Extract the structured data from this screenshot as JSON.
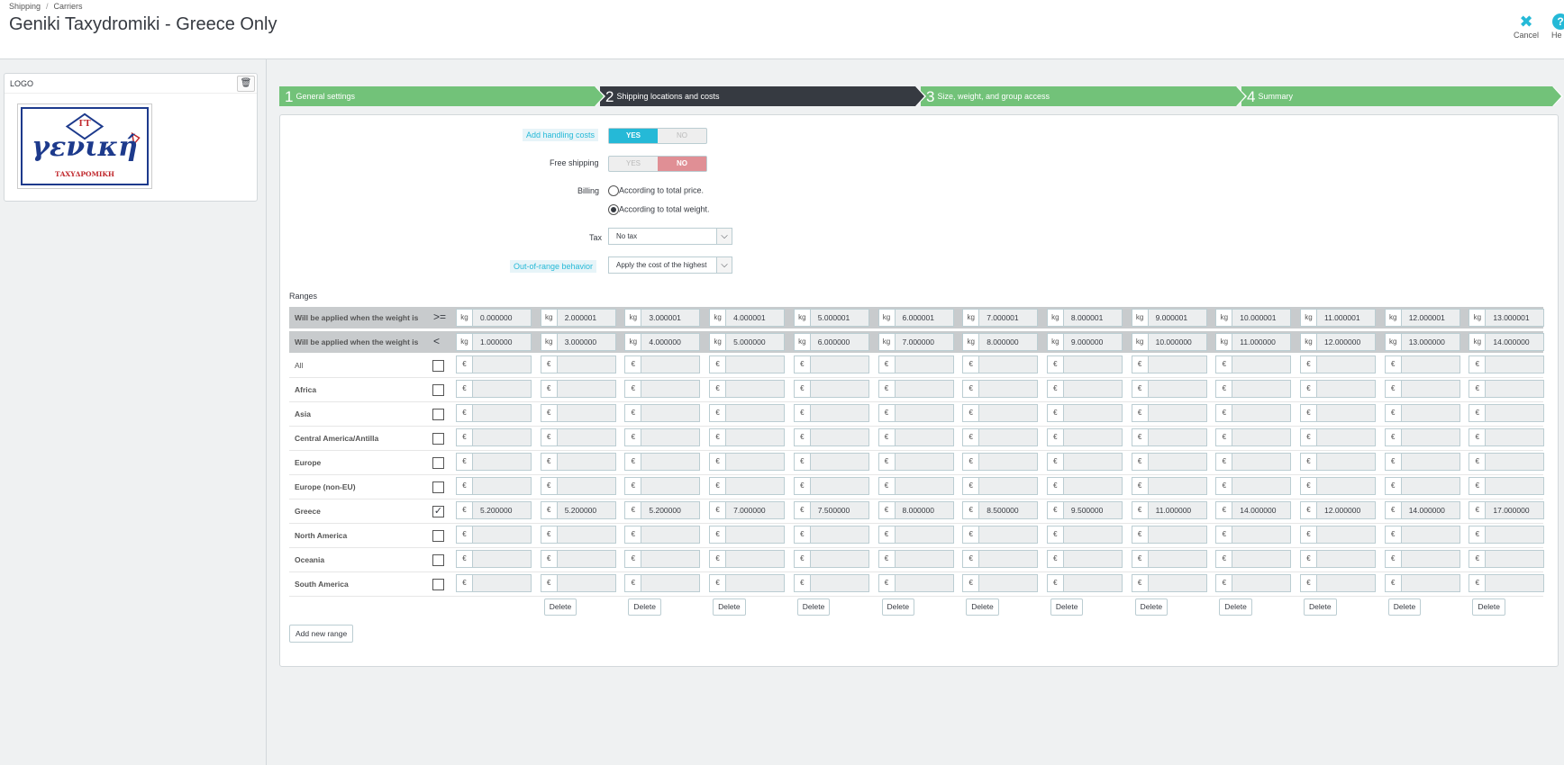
{
  "breadcrumb": [
    "Shipping",
    "Carriers"
  ],
  "page_title": "Geniki Taxydromiki - Greece Only",
  "toolbar": {
    "cancel": "Cancel",
    "help": "He"
  },
  "sidebar": {
    "logo_label": "LOGO",
    "logo_text_main": "γενική",
    "logo_text_sub": "ΤΑΧΥΔΡΟΜΙΚΗ",
    "logo_mono": "ΓΤ"
  },
  "steps": [
    {
      "num": "1",
      "label": "General settings"
    },
    {
      "num": "2",
      "label": "Shipping locations and costs"
    },
    {
      "num": "3",
      "label": "Size, weight, and group access"
    },
    {
      "num": "4",
      "label": "Summary"
    }
  ],
  "form": {
    "handling_label": "Add handling costs",
    "handling_value": "YES",
    "free_label": "Free shipping",
    "free_value": "NO",
    "yes": "YES",
    "no": "NO",
    "billing_label": "Billing",
    "billing_options": [
      "According to total price.",
      "According to total weight."
    ],
    "billing_selected": "According to total weight.",
    "tax_label": "Tax",
    "tax_value": "No tax",
    "oor_label": "Out-of-range behavior",
    "oor_value": "Apply the cost of the highest"
  },
  "ranges": {
    "title": "Ranges",
    "cond_label": "Will be applied when the weight is",
    "sym_ge": ">=",
    "sym_lt": "<",
    "unit": "kg",
    "currency": "€",
    "from": [
      "0.000000",
      "2.000001",
      "3.000001",
      "4.000001",
      "5.000001",
      "6.000001",
      "7.000001",
      "8.000001",
      "9.000001",
      "10.000001",
      "11.000001",
      "12.000001",
      "13.000001"
    ],
    "to": [
      "1.000000",
      "3.000000",
      "4.000000",
      "5.000000",
      "6.000000",
      "7.000000",
      "8.000000",
      "9.000000",
      "10.000000",
      "11.000000",
      "12.000000",
      "13.000000",
      "14.000000"
    ],
    "zones": [
      {
        "name": "All",
        "checked": false,
        "values": []
      },
      {
        "name": "Africa",
        "checked": false,
        "values": []
      },
      {
        "name": "Asia",
        "checked": false,
        "values": []
      },
      {
        "name": "Central America/Antilla",
        "checked": false,
        "values": []
      },
      {
        "name": "Europe",
        "checked": false,
        "values": []
      },
      {
        "name": "Europe (non-EU)",
        "checked": false,
        "values": []
      },
      {
        "name": "Greece",
        "checked": true,
        "values": [
          "5.200000",
          "5.200000",
          "5.200000",
          "7.000000",
          "7.500000",
          "8.000000",
          "8.500000",
          "9.500000",
          "11.000000",
          "14.000000",
          "12.000000",
          "14.000000",
          "17.000000"
        ]
      },
      {
        "name": "North America",
        "checked": false,
        "values": []
      },
      {
        "name": "Oceania",
        "checked": false,
        "values": []
      },
      {
        "name": "South America",
        "checked": false,
        "values": []
      }
    ],
    "delete_label": "Delete",
    "add_label": "Add new range"
  }
}
